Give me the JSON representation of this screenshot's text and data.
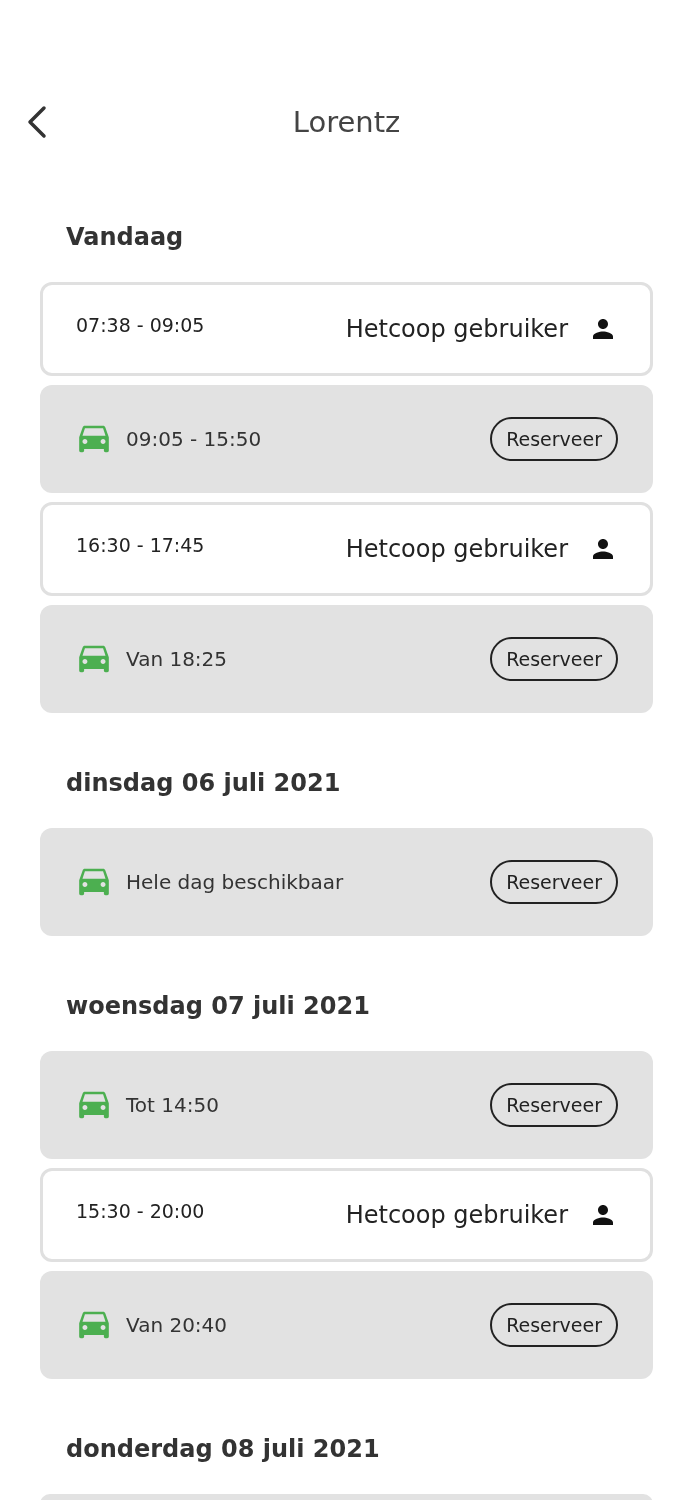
{
  "header": {
    "title": "Lorentz"
  },
  "sections": [
    {
      "title": "Vandaag",
      "slots": [
        {
          "kind": "booked",
          "time": "07:38 - 09:05",
          "user": "Hetcoop gebruiker"
        },
        {
          "kind": "free",
          "label": "09:05 - 15:50",
          "button": "Reserveer"
        },
        {
          "kind": "booked",
          "time": "16:30 - 17:45",
          "user": "Hetcoop gebruiker"
        },
        {
          "kind": "free",
          "label": "Van 18:25",
          "button": "Reserveer"
        }
      ]
    },
    {
      "title": "dinsdag 06 juli 2021",
      "slots": [
        {
          "kind": "free",
          "label": "Hele dag beschikbaar",
          "button": "Reserveer"
        }
      ]
    },
    {
      "title": "woensdag 07 juli 2021",
      "slots": [
        {
          "kind": "free",
          "label": "Tot 14:50",
          "button": "Reserveer"
        },
        {
          "kind": "booked",
          "time": "15:30 - 20:00",
          "user": "Hetcoop gebruiker"
        },
        {
          "kind": "free",
          "label": "Van 20:40",
          "button": "Reserveer"
        }
      ]
    },
    {
      "title": "donderdag 08 juli 2021",
      "slots": [
        {
          "kind": "cut"
        }
      ]
    }
  ]
}
